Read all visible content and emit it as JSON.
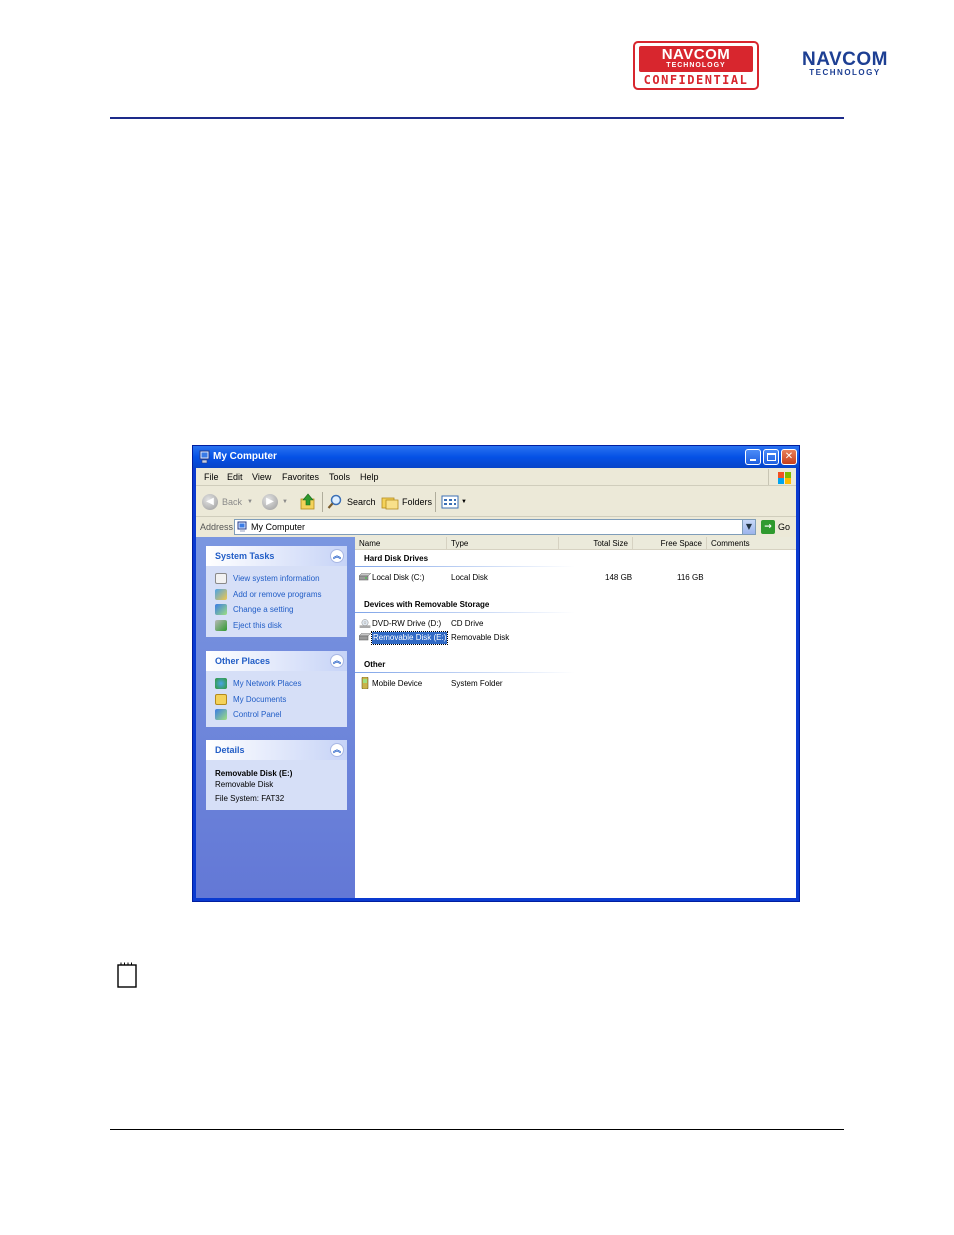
{
  "header": {
    "stamp_line1": "NAVCOM",
    "stamp_line2": "TECHNOLOGY",
    "stamp_line3": "CONFIDENTIAL",
    "logo_line1": "NAVCOM",
    "logo_line2": "TECHNOLOGY"
  },
  "window": {
    "title": "My Computer",
    "menu": [
      "File",
      "Edit",
      "View",
      "Favorites",
      "Tools",
      "Help"
    ],
    "toolbar": {
      "back": "Back",
      "search": "Search",
      "folders": "Folders"
    },
    "address": {
      "label": "Address",
      "value": "My Computer",
      "go": "Go"
    },
    "left_pane": {
      "system_tasks": {
        "title": "System Tasks",
        "items": [
          "View system information",
          "Add or remove programs",
          "Change a setting",
          "Eject this disk"
        ]
      },
      "other_places": {
        "title": "Other Places",
        "items": [
          "My Network Places",
          "My Documents",
          "Control Panel"
        ]
      },
      "details": {
        "title": "Details",
        "name": "Removable Disk (E:)",
        "type": "Removable Disk",
        "fs": "File System: FAT32"
      }
    },
    "columns": [
      "Name",
      "Type",
      "Total Size",
      "Free Space",
      "Comments"
    ],
    "groups": {
      "hdd": {
        "title": "Hard Disk Drives",
        "items": [
          {
            "name": "Local Disk (C:)",
            "type": "Local Disk",
            "total": "148 GB",
            "free": "116 GB"
          }
        ]
      },
      "removable": {
        "title": "Devices with Removable Storage",
        "items": [
          {
            "name": "DVD-RW Drive (D:)",
            "type": "CD Drive"
          },
          {
            "name": "Removable Disk (E:)",
            "type": "Removable Disk"
          }
        ]
      },
      "other": {
        "title": "Other",
        "items": [
          {
            "name": "Mobile Device",
            "type": "System Folder"
          }
        ]
      }
    }
  },
  "colors": {
    "rule": "#1d2b8a",
    "stamp_red": "#d8262e",
    "titlebar_blue": "#0551e6",
    "selection": "#316ac5"
  }
}
